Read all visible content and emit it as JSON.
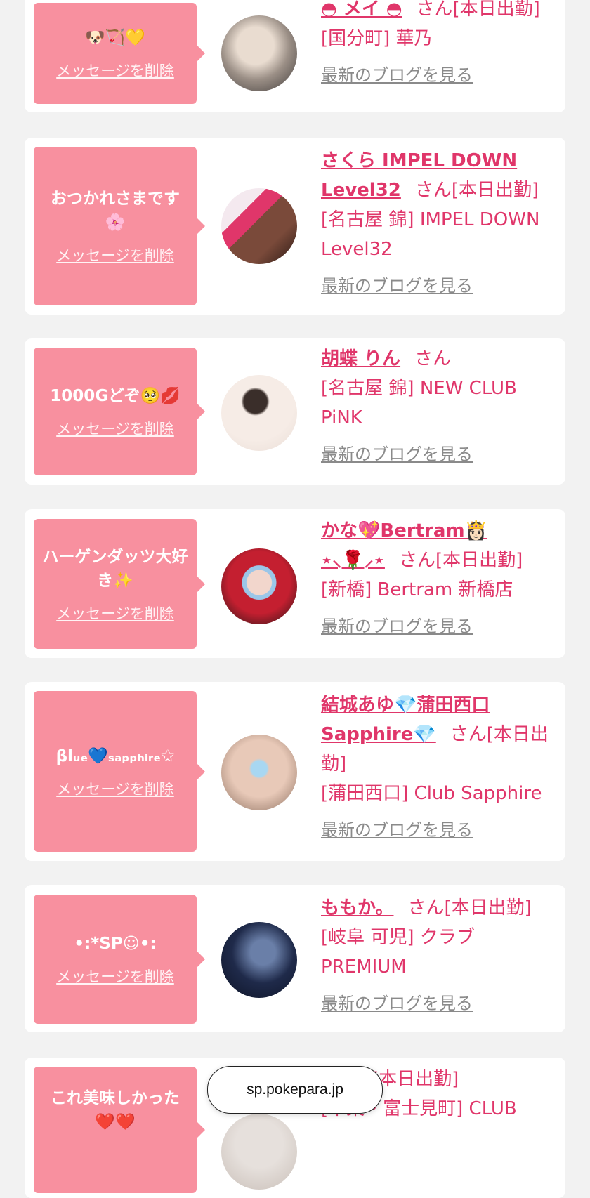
{
  "delete_label": "メッセージを削除",
  "blog_label": "最新のブログを見る",
  "url_bar": "sp.pokepara.jp",
  "colors": {
    "accent": "#e0366a",
    "bubble": "#f8909f",
    "background": "#f2f2f2"
  },
  "items": [
    {
      "message": "🐶🏹💛",
      "name": "◓ メイ ◓",
      "suffix": "さん[本日出勤]",
      "location": "[国分町] 華乃",
      "avatar": "avatar-photo-blonde"
    },
    {
      "message": "おつかれさまです🌸",
      "name": "さくら IMPEL DOWN Level32",
      "suffix": "さん[本日出勤]",
      "location": "[名古屋 錦] IMPEL DOWN Level32",
      "avatar": "avatar-photo-logo"
    },
    {
      "message": "1000Gどぞ🥺💋",
      "name": "胡蝶 りん",
      "suffix": "さん",
      "location": "[名古屋 錦] NEW CLUB PiNK",
      "avatar": "avatar-photo-white"
    },
    {
      "message": "ハーゲンダッツ大好き✨",
      "name": "かな💖Bertram👸🏻 ⋆⸜🌹⸝⋆",
      "suffix": "さん[本日出勤]",
      "location": "[新橋] Bertram 新橋店",
      "avatar": "avatar-photo-christmas"
    },
    {
      "message": "βlᵤₑ💙ₛₐₚₚₕᵢᵣₑ✩",
      "name": "結城あゆ💎蒲田西口Sapphire💎",
      "suffix": "さん[本日出勤]",
      "location": "[蒲田西口] Club Sapphire",
      "avatar": "avatar-photo-sparkle"
    },
    {
      "message": "•:*SP☺︎•:",
      "name": "ももか。",
      "suffix": "さん[本日出勤]",
      "location": "[岐阜 可児] クラブ PREMIUM",
      "avatar": "avatar-photo-night"
    },
    {
      "message": "これ美味しかった❤️❤️",
      "name": "",
      "suffix": "さん[本日出勤]",
      "location": "[千葉・富士見町] CLUB",
      "avatar": "avatar-photo-partial"
    }
  ]
}
